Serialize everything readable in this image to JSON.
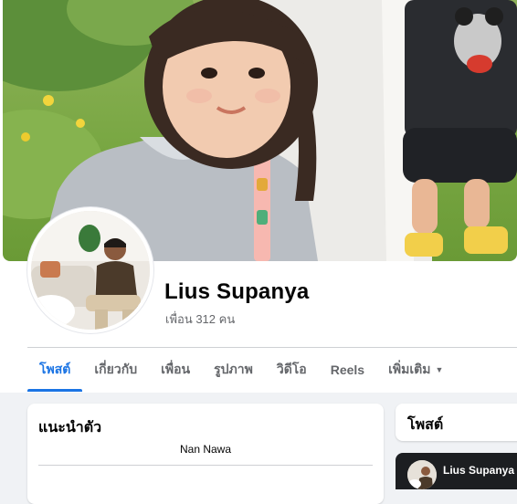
{
  "profile": {
    "name": "Lius Supanya",
    "friends": "เพื่อน 312 คน"
  },
  "tabs": [
    {
      "label": "โพสต์",
      "active": true
    },
    {
      "label": "เกี่ยวกับ",
      "active": false
    },
    {
      "label": "เพื่อน",
      "active": false
    },
    {
      "label": "รูปภาพ",
      "active": false
    },
    {
      "label": "วิดีโอ",
      "active": false
    },
    {
      "label": "Reels",
      "active": false
    },
    {
      "label": "เพิ่มเติม",
      "active": false,
      "has_dropdown": true
    }
  ],
  "intro": {
    "title": "แนะนำตัว",
    "bio": "Nan Nawa"
  },
  "posts": {
    "title": "โพสต์",
    "preview_author": "Lius Supanya · "
  },
  "colors": {
    "accent": "#1b74e4",
    "background": "#f0f2f5",
    "secondary_text": "#65676b"
  },
  "icons": {
    "more_tab": "chevron-down-icon"
  }
}
